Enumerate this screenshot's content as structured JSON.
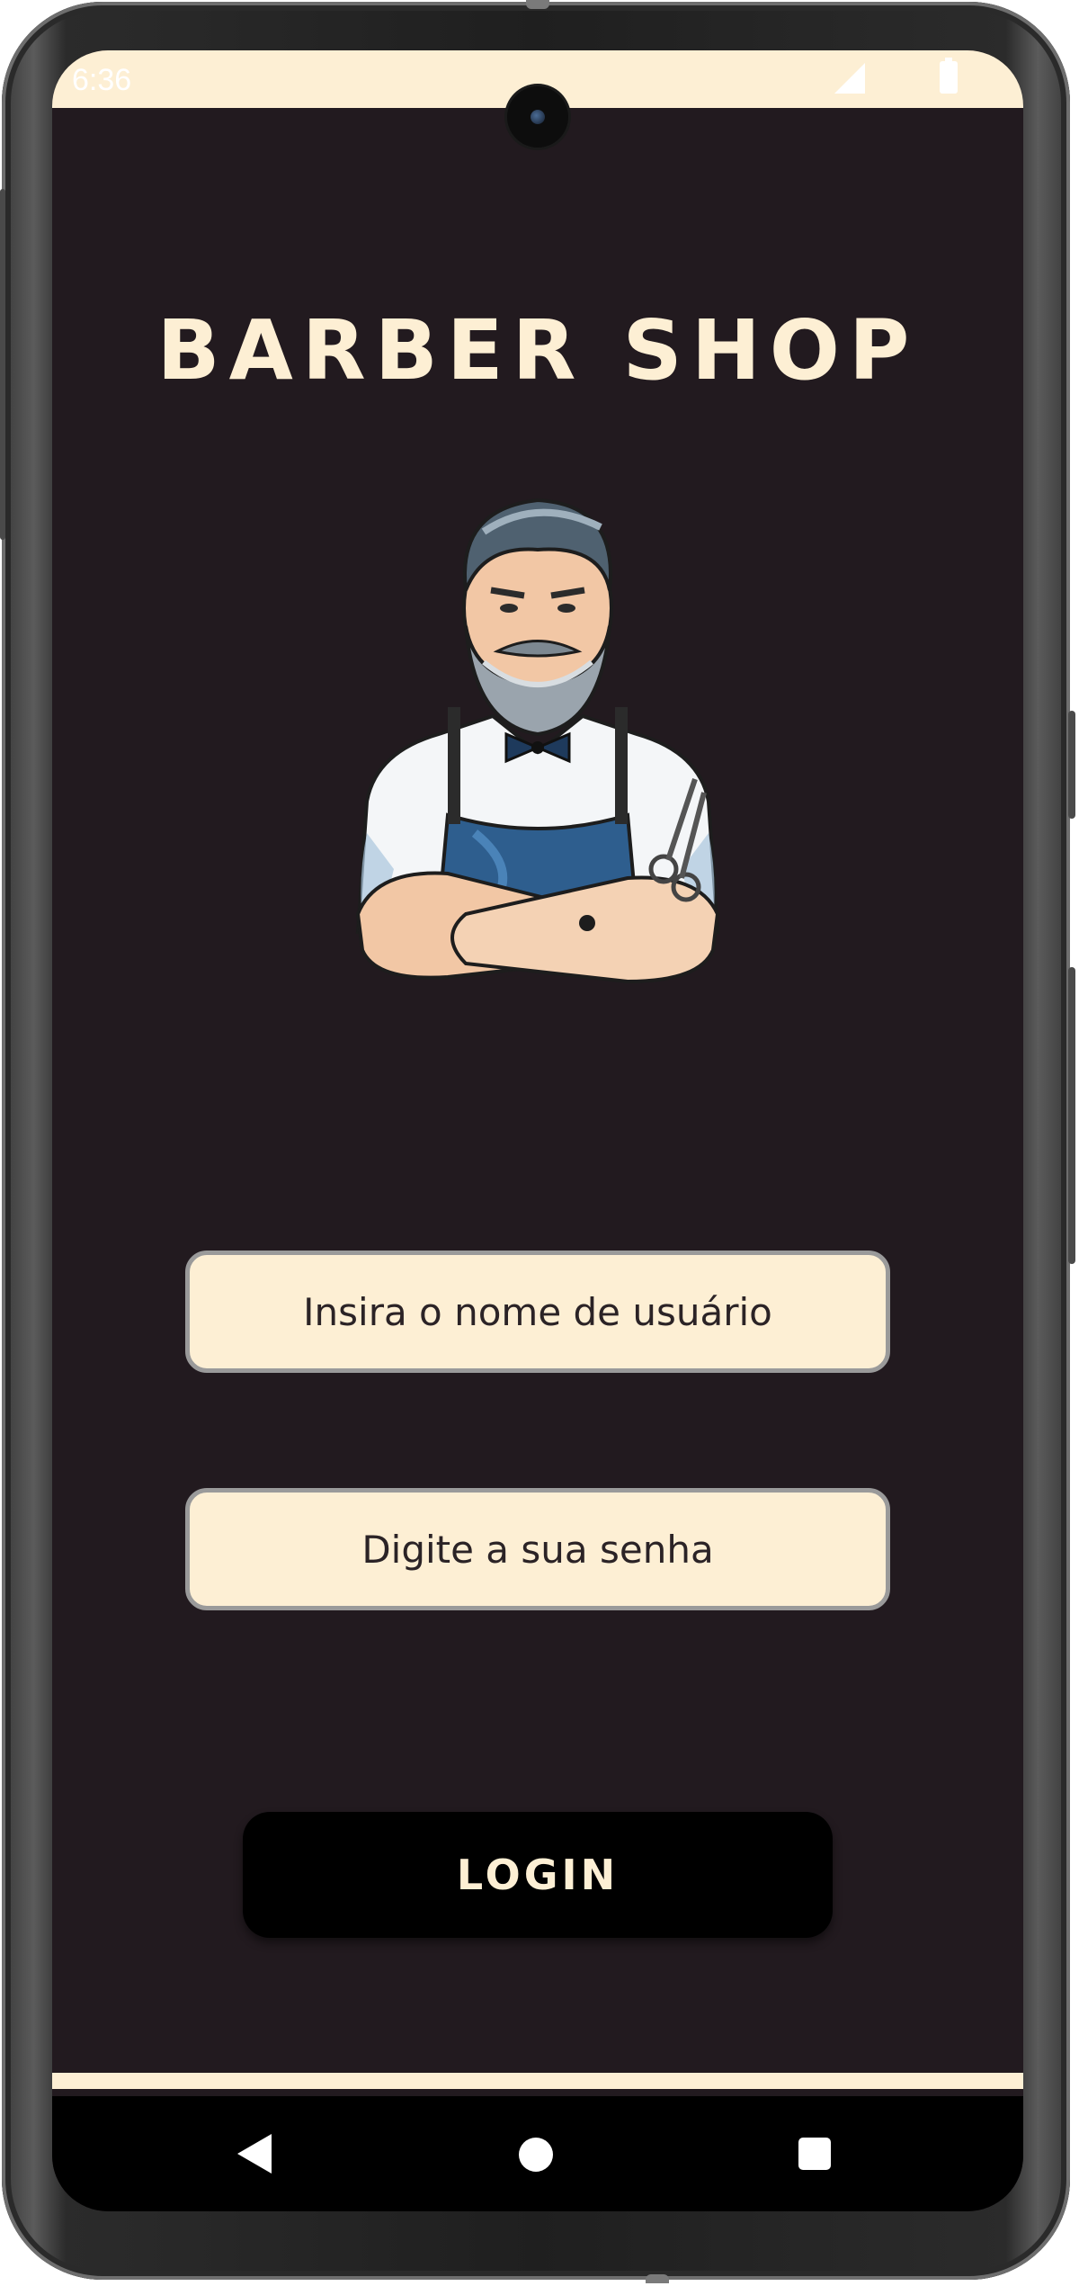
{
  "status_bar": {
    "time": "6:36",
    "signal_icon": "signal-icon",
    "battery_icon": "battery-icon"
  },
  "app": {
    "title": "BARBER SHOP",
    "logo_icon": "barber-illustration-icon"
  },
  "form": {
    "username_placeholder": "Insira o nome de usuário",
    "password_placeholder": "Digite a sua senha",
    "login_label": "LOGIN"
  },
  "nav": {
    "back_icon": "back-triangle-icon",
    "home_icon": "home-circle-icon",
    "recents_icon": "recents-square-icon"
  },
  "colors": {
    "background": "#221a1f",
    "accent_cream": "#fdefd4",
    "button": "#000000"
  }
}
